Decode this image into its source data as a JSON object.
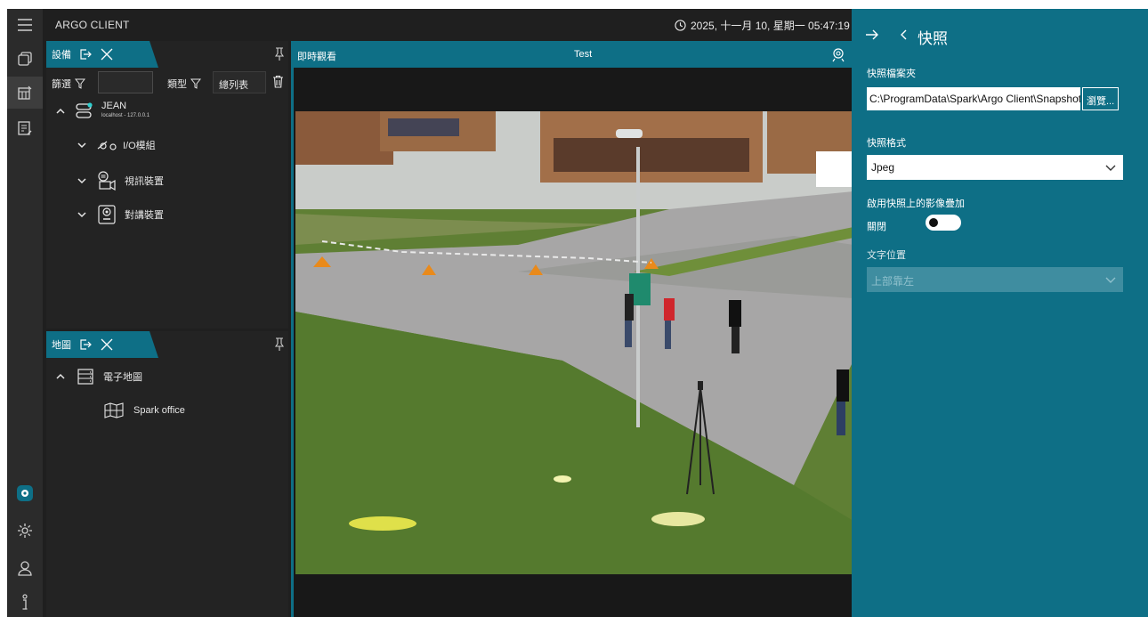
{
  "app": {
    "title": "ARGO CLIENT"
  },
  "clock": {
    "text": "2025, 十一月 10, 星期一 05:47:19"
  },
  "device_panel": {
    "tab_label": "設備",
    "filter_label": "篩選",
    "filter_value": "",
    "type_label": "類型",
    "view_select": "總列表",
    "tree": {
      "server_name": "JEAN",
      "server_address": "localhost - 127.0.0.1",
      "children": [
        {
          "label": "I/O模組",
          "icon": "io-module-icon"
        },
        {
          "label": "視訊裝置",
          "icon": "camera-icon"
        },
        {
          "label": "對講裝置",
          "icon": "intercom-icon"
        }
      ]
    }
  },
  "map_panel": {
    "tab_label": "地圖",
    "group_label": "電子地圖",
    "items": [
      {
        "label": "Spark office",
        "icon": "map-icon"
      }
    ]
  },
  "liveview": {
    "header_left": "即時觀看",
    "header_center": "Test"
  },
  "snapshot_panel": {
    "title": "快照",
    "folder_label": "快照檔案夾",
    "folder_value": "C:\\ProgramData\\Spark\\Argo Client\\Snapshot",
    "browse_button": "瀏覽...",
    "format_label": "快照格式",
    "format_value": "Jpeg",
    "overlay_label": "啟用快照上的影像疊加",
    "overlay_toggle_text": "關閉",
    "overlay_enabled": false,
    "text_position_label": "文字位置",
    "text_position_value": "上部靠左"
  },
  "rail": {
    "icons": [
      "menu-icon",
      "windows-icon",
      "layout-icon",
      "notes-icon",
      "settings-icon",
      "gear-icon",
      "user-icon",
      "info-icon"
    ]
  },
  "colors": {
    "accent": "#0e6f86",
    "background": "#1f1f1f",
    "panel": "#232323"
  }
}
